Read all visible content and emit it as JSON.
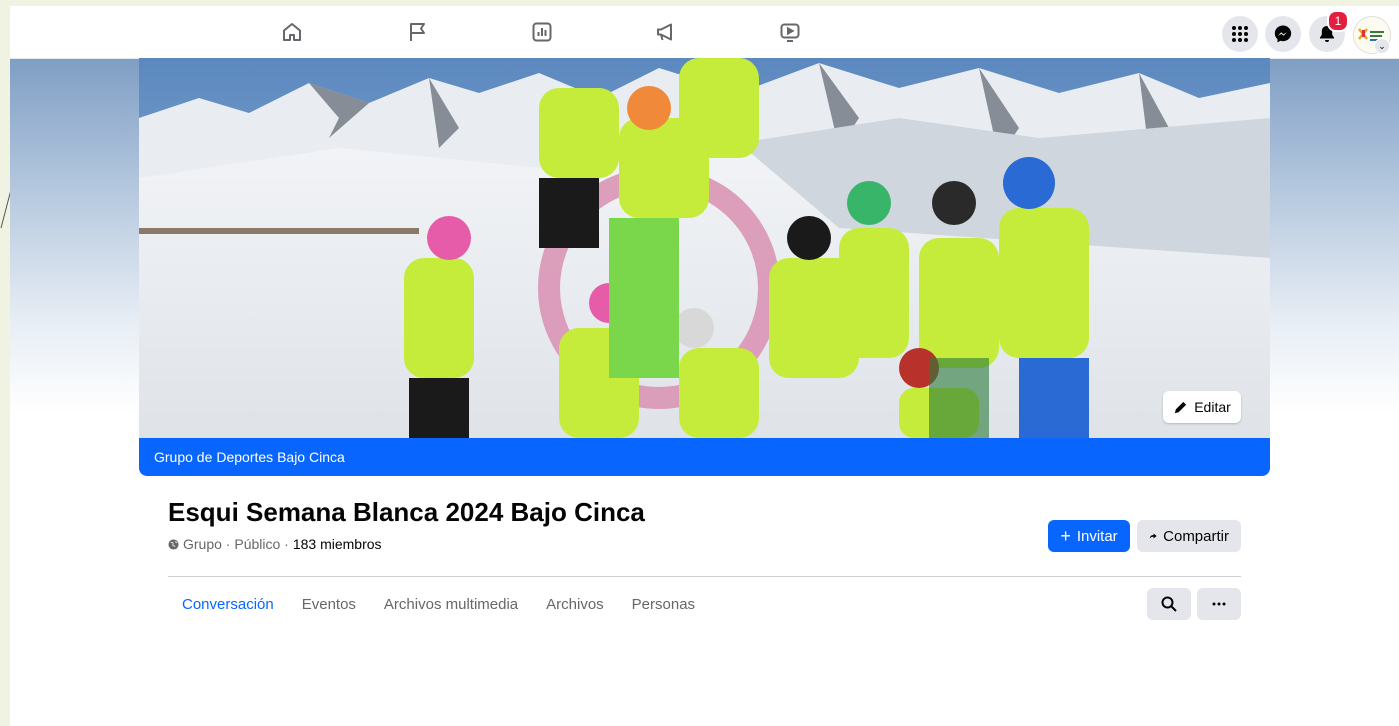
{
  "colors": {
    "accent": "#0866ff",
    "notification_badge": "#e41e3f",
    "page_background": "#ffffff",
    "outer_background": "#f0f3e2"
  },
  "topnav": {
    "tabs": [
      {
        "icon": "home-icon"
      },
      {
        "icon": "flag-icon"
      },
      {
        "icon": "dashboard-icon"
      },
      {
        "icon": "megaphone-icon"
      },
      {
        "icon": "video-icon"
      }
    ],
    "menu_icon": "grid-menu-icon",
    "messenger_icon": "messenger-icon",
    "notifications": {
      "icon": "bell-icon",
      "count": "1"
    },
    "profile_icon": "profile-avatar"
  },
  "cover": {
    "edit_label": "Editar"
  },
  "group_bar": {
    "prefix": "Grupo de",
    "parent_group": "Deportes Bajo Cinca"
  },
  "group": {
    "title": "Esqui Semana Blanca 2024 Bajo Cinca",
    "privacy": "Grupo · Público ·",
    "members": "183 miembros"
  },
  "actions": {
    "invite_label": "Invitar",
    "share_label": "Compartir"
  },
  "tabs": [
    {
      "label": "Conversación",
      "active": true
    },
    {
      "label": "Eventos",
      "active": false
    },
    {
      "label": "Archivos multimedia",
      "active": false
    },
    {
      "label": "Archivos",
      "active": false
    },
    {
      "label": "Personas",
      "active": false
    }
  ]
}
